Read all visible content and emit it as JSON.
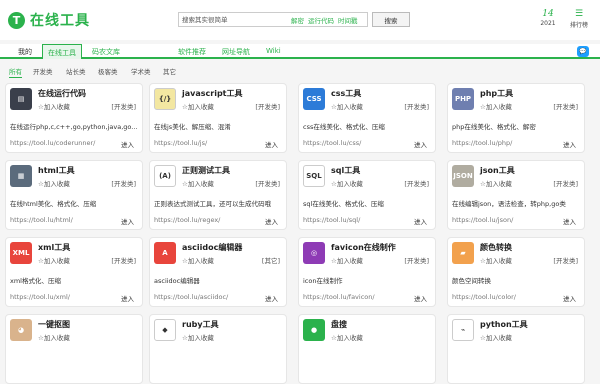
{
  "header": {
    "logo_char": "T",
    "logo_text": "在线工具",
    "search_placeholder": "搜索其实很简单",
    "quick_links": [
      "解密",
      "运行代码",
      "时间戳"
    ],
    "search_button": "搜索",
    "date_day": "14",
    "date_year": "2021",
    "rank_icon": "list-icon",
    "rank_label": "排行榜"
  },
  "nav": {
    "items": [
      "我的",
      "在线工具",
      "码农文库",
      "软件推荐",
      "网址导航",
      "Wiki"
    ],
    "active": "在线工具",
    "right_icon": "chat-bubble-icon"
  },
  "subcats": [
    "所有",
    "开发类",
    "站长类",
    "极客类",
    "学术类",
    "其它"
  ],
  "colors": {
    "brand": "#2bb24c",
    "nav_icon_bg": "#1e9fff"
  },
  "fav_label": "☆加入收藏",
  "enter_label": "进入",
  "cards": [
    {
      "title": "在线运行代码",
      "icon": "code-runner-icon",
      "icon_text": "▤",
      "icon_bg": "#3a3f4b",
      "tag": "[开发类]",
      "desc": "在线运行php,c,c++,go,python,java,go...",
      "url": "https://tool.lu/coderunner/"
    },
    {
      "title": "javascript工具",
      "icon": "javascript-icon",
      "icon_text": "{/}",
      "icon_bg": "#f3e7a1",
      "tag": "[开发类]",
      "desc": "在线js美化、解压缩、混淆",
      "url": "https://tool.lu/js/"
    },
    {
      "title": "css工具",
      "icon": "css-icon",
      "icon_text": "CSS",
      "icon_bg": "#2c7bd8",
      "tag": "[开发类]",
      "desc": "css在线美化、格式化、压缩",
      "url": "https://tool.lu/css/"
    },
    {
      "title": "php工具",
      "icon": "php-icon",
      "icon_text": "PHP",
      "icon_bg": "#6f7fb0",
      "tag": "[开发类]",
      "desc": "php在线美化、格式化、解密",
      "url": "https://tool.lu/php/"
    },
    {
      "title": "html工具",
      "icon": "html-icon",
      "icon_text": "▦",
      "icon_bg": "#5b6b7c",
      "tag": "[开发类]",
      "desc": "在线html美化、格式化、压缩",
      "url": "https://tool.lu/html/"
    },
    {
      "title": "正则测试工具",
      "icon": "regex-icon",
      "icon_text": "(A)",
      "icon_bg": "#ffffff",
      "tag": "[开发类]",
      "desc": "正则表达式测试工具，还可以生成代码哦",
      "url": "https://tool.lu/regex/"
    },
    {
      "title": "sql工具",
      "icon": "sql-icon",
      "icon_text": "SQL",
      "icon_bg": "#ffffff",
      "tag": "[开发类]",
      "desc": "sql在线美化、格式化、压缩",
      "url": "https://tool.lu/sql/"
    },
    {
      "title": "json工具",
      "icon": "json-icon",
      "icon_text": "JSON",
      "icon_bg": "#b0aca0",
      "tag": "[开发类]",
      "desc": "在线编辑json，语法检查，转php,go类",
      "url": "https://tool.lu/json/"
    },
    {
      "title": "xml工具",
      "icon": "xml-icon",
      "icon_text": "XML",
      "icon_bg": "#e8453c",
      "tag": "[开发类]",
      "desc": "xml格式化、压缩",
      "url": "https://tool.lu/xml/"
    },
    {
      "title": "asciidoc编辑器",
      "icon": "asciidoc-icon",
      "icon_text": "A",
      "icon_bg": "#e8453c",
      "tag": "[其它]",
      "desc": "asciidoc编辑器",
      "url": "https://tool.lu/asciidoc/"
    },
    {
      "title": "favicon在线制作",
      "icon": "favicon-icon",
      "icon_text": "◎",
      "icon_bg": "#8e3bb5",
      "tag": "[开发类]",
      "desc": "icon在线制作",
      "url": "https://tool.lu/favicon/"
    },
    {
      "title": "颜色转换",
      "icon": "color-palette-icon",
      "icon_text": "▰",
      "icon_bg": "#f2a14d",
      "tag": "[开发类]",
      "desc": "颜色空间转换",
      "url": "https://tool.lu/color/"
    },
    {
      "title": "一键抠图",
      "icon": "cutout-icon",
      "icon_text": "◕",
      "icon_bg": "#d9b38c",
      "tag": "",
      "desc": "",
      "url": ""
    },
    {
      "title": "ruby工具",
      "icon": "ruby-icon",
      "icon_text": "◆",
      "icon_bg": "#ffffff",
      "tag": "",
      "desc": "",
      "url": ""
    },
    {
      "title": "盘搜",
      "icon": "pansou-icon",
      "icon_text": "●",
      "icon_bg": "#2bb24c",
      "tag": "",
      "desc": "",
      "url": ""
    },
    {
      "title": "python工具",
      "icon": "python-icon",
      "icon_text": "⌁",
      "icon_bg": "#ffffff",
      "tag": "",
      "desc": "",
      "url": ""
    }
  ]
}
